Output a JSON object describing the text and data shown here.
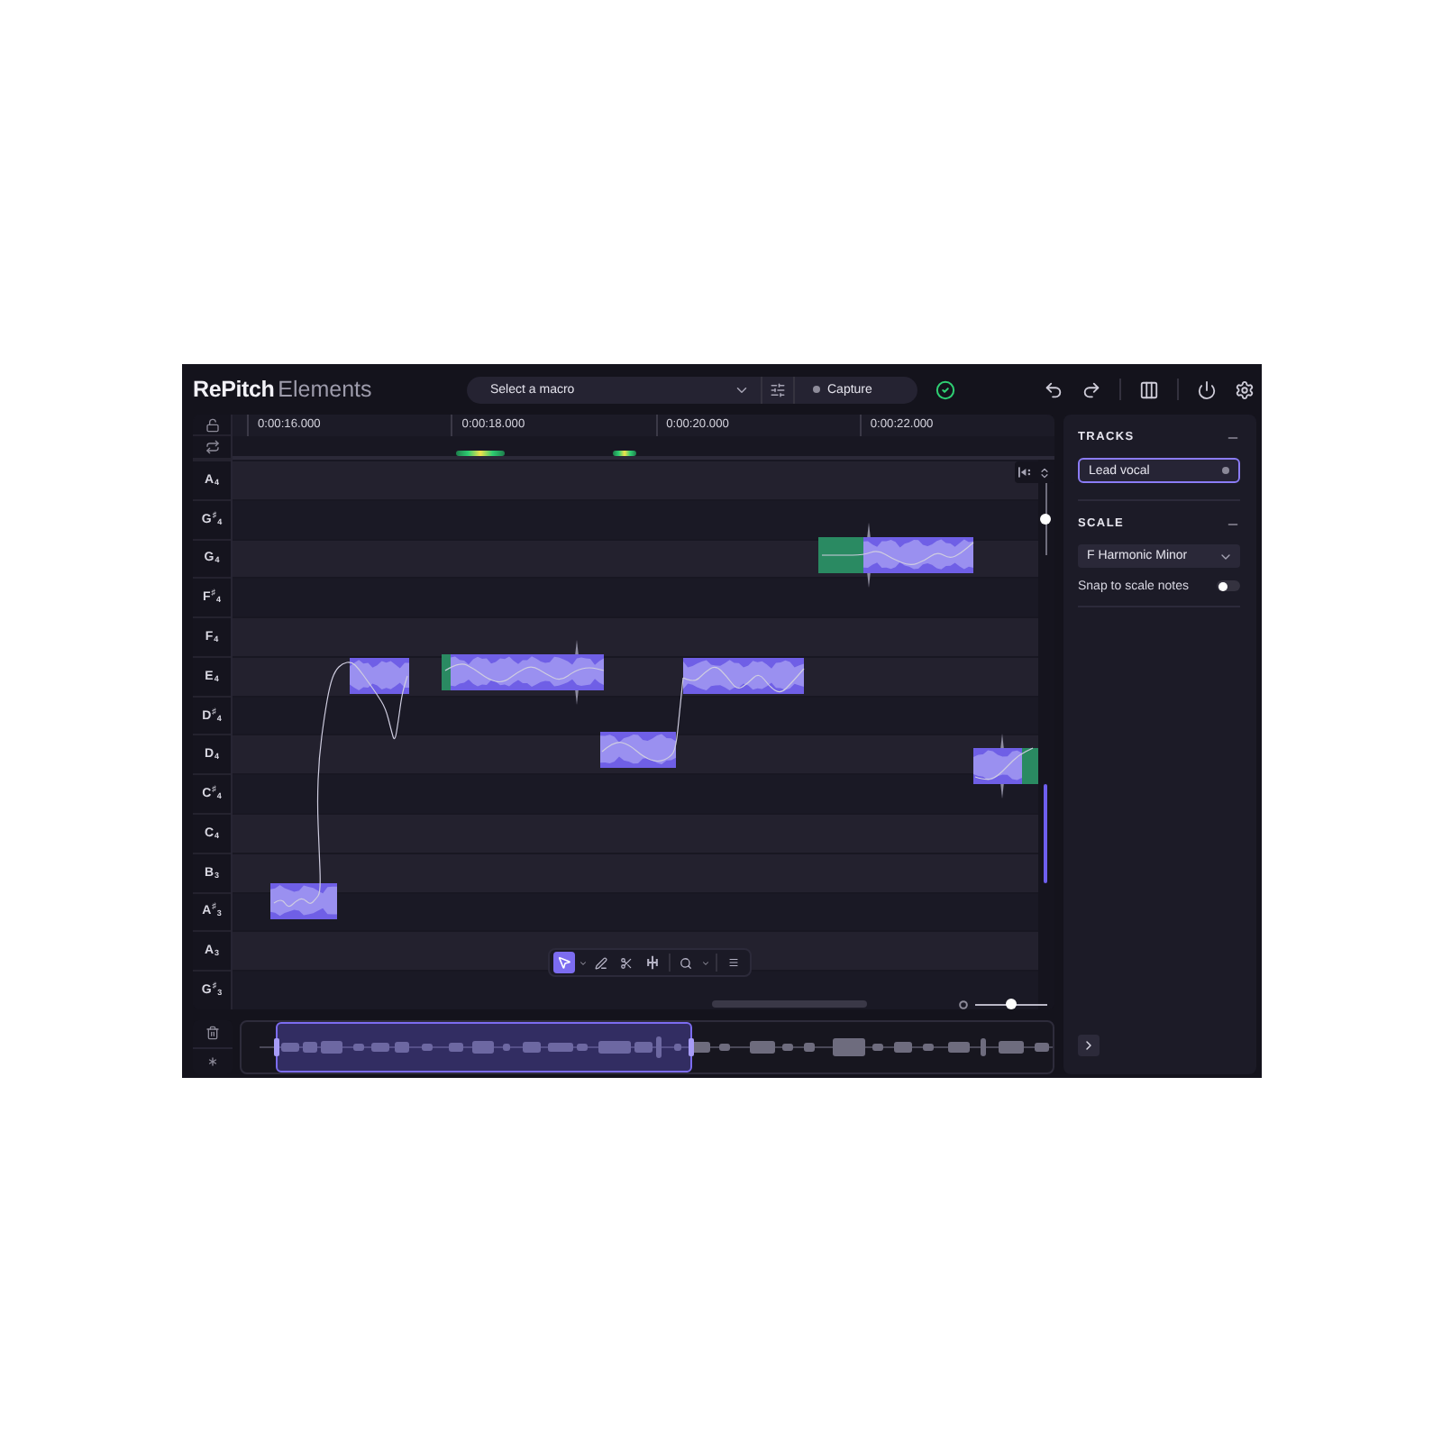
{
  "brand": {
    "name": "RePitch",
    "edition": "Elements"
  },
  "header": {
    "macro_select": {
      "label": "Select a macro"
    },
    "capture": {
      "label": "Capture"
    }
  },
  "timeline": {
    "ticks": [
      "0:00:16.000",
      "0:00:18.000",
      "0:00:20.000",
      "0:00:22.000"
    ]
  },
  "pitch_rows": [
    {
      "label": "A$_{4}$",
      "kind": "white"
    },
    {
      "label": "G$^{♯}$$_{4}$",
      "kind": "black"
    },
    {
      "label": "G$_{4}$",
      "kind": "white"
    },
    {
      "label": "F$^{♯}$$_{4}$",
      "kind": "black"
    },
    {
      "label": "F$_{4}$",
      "kind": "white"
    },
    {
      "label": "E$_{4}$",
      "kind": "white"
    },
    {
      "label": "D$^{♯}$$_{4}$",
      "kind": "black"
    },
    {
      "label": "D$_{4}$",
      "kind": "white"
    },
    {
      "label": "C$^{♯}$$_{4}$",
      "kind": "black"
    },
    {
      "label": "C$_{4}$",
      "kind": "white"
    },
    {
      "label": "B$_{3}$",
      "kind": "white"
    },
    {
      "label": "A$^{♯}$$_{3}$",
      "kind": "black"
    },
    {
      "label": "A$_{3}$",
      "kind": "white"
    },
    {
      "label": "G$^{♯}$$_{3}$",
      "kind": "black"
    }
  ],
  "tool_groups": [
    [
      {
        "kind": "select",
        "selected": true,
        "menu": true
      },
      {
        "kind": "pen",
        "selected": false,
        "menu": false
      },
      {
        "kind": "scissors",
        "selected": false,
        "menu": false
      },
      {
        "kind": "stretch",
        "selected": false,
        "menu": false
      }
    ],
    [
      {
        "kind": "zoom",
        "selected": false,
        "menu": true
      }
    ],
    [
      {
        "kind": "more",
        "selected": false,
        "menu": false
      }
    ]
  ],
  "vertical_zoom": {
    "level": 0.5
  },
  "horizontal_zoom": {
    "level": 0.5
  },
  "tracks": {
    "title": "TRACKS",
    "items": [
      {
        "name": "Lead vocal",
        "selected": true
      }
    ]
  },
  "scale": {
    "title": "SCALE",
    "value": "F Harmonic Minor",
    "snap": {
      "label": "Snap to scale notes",
      "on": false
    }
  }
}
